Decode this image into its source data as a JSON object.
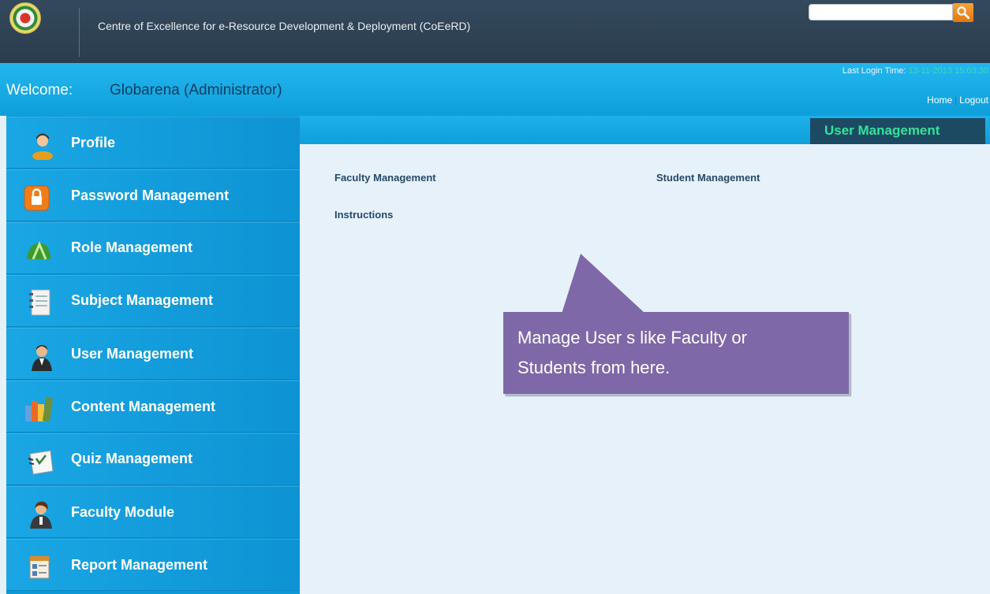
{
  "header": {
    "title": "Centre of Excellence for e-Resource Development & Deployment (CoEeRD)",
    "logo_caption": "",
    "search": {
      "placeholder": "",
      "value": ""
    },
    "search_button_icon": "search-icon"
  },
  "welcome": {
    "label": "Welcome:",
    "user": "Globarena (Administrator)",
    "last_login_label": "Last Login Time:",
    "last_login_time": "13-11-2013 15:03:30",
    "links": {
      "home": "Home",
      "separator": "|",
      "logout": "Logout"
    }
  },
  "sidebar": {
    "items": [
      {
        "label": "Profile",
        "icon": "user-profile-icon"
      },
      {
        "label": "Password Management",
        "icon": "lock-icon"
      },
      {
        "label": "Role Management",
        "icon": "role-icon"
      },
      {
        "label": "Subject Management",
        "icon": "notebook-icon"
      },
      {
        "label": "User Management",
        "icon": "user-management-icon"
      },
      {
        "label": "Content Management",
        "icon": "books-icon"
      },
      {
        "label": "Quiz Management",
        "icon": "quiz-icon"
      },
      {
        "label": "Faculty Module",
        "icon": "faculty-icon"
      },
      {
        "label": "Report Management",
        "icon": "report-icon"
      }
    ]
  },
  "main": {
    "section_title": "User Management",
    "links": {
      "faculty": "Faculty Management",
      "student": "Student Management",
      "instructions": "Instructions"
    },
    "callout": {
      "line1": "Manage User s like Faculty or",
      "line2": "Students from here."
    }
  },
  "colors": {
    "header_bg": "#2f4357",
    "accent_blue": "#0e9fdb",
    "section_tab_bg": "#1c4a63",
    "section_tab_text": "#34e39b",
    "callout_bg": "#7f68a8",
    "search_button": "#f08a1e",
    "last_login_time": "#3fd6c2"
  }
}
